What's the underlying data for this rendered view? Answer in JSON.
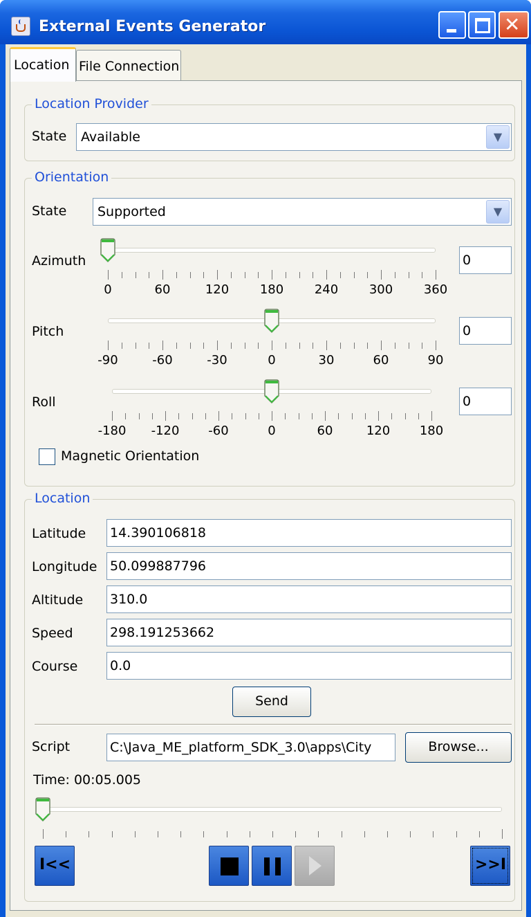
{
  "window": {
    "title": "External Events Generator",
    "title_icon": "java-cup-icon",
    "controls": [
      "minimize-icon",
      "maximize-icon",
      "close-icon"
    ],
    "close_glyph": "✕"
  },
  "tabs": [
    {
      "label": "Location",
      "active": true
    },
    {
      "label": "File Connection",
      "active": false
    }
  ],
  "location_provider": {
    "group_title": "Location Provider",
    "state_label": "State",
    "state_value": "Available"
  },
  "orientation": {
    "group_title": "Orientation",
    "state_label": "State",
    "state_value": "Supported",
    "azimuth": {
      "label": "Azimuth",
      "value": "0",
      "min": 0,
      "max": 360,
      "current": 0,
      "tick_labels": [
        "0",
        "60",
        "120",
        "180",
        "240",
        "300",
        "360"
      ]
    },
    "pitch": {
      "label": "Pitch",
      "value": "0",
      "min": -90,
      "max": 90,
      "current": 0,
      "tick_labels": [
        "-90",
        "-60",
        "-30",
        "0",
        "30",
        "60",
        "90"
      ]
    },
    "roll": {
      "label": "Roll",
      "value": "0",
      "min": -180,
      "max": 180,
      "current": 0,
      "tick_labels": [
        "-180",
        "-120",
        "-60",
        "0",
        "60",
        "120",
        "180"
      ]
    },
    "magnetic_label": "Magnetic Orientation",
    "magnetic_checked": false
  },
  "location": {
    "group_title": "Location",
    "fields": [
      {
        "label": "Latitude",
        "value": "14.390106818"
      },
      {
        "label": "Longitude",
        "value": "50.099887796"
      },
      {
        "label": "Altitude",
        "value": "310.0"
      },
      {
        "label": "Speed",
        "value": "298.191253662"
      },
      {
        "label": "Course",
        "value": "0.0"
      }
    ],
    "send_label": "Send",
    "script_label": "Script",
    "script_value": "C:\\Java_ME_platform_SDK_3.0\\apps\\City",
    "browse_label": "Browse...",
    "time_label": "Time: 00:05.005",
    "time_position": 0.0
  },
  "player": {
    "rewind_label": "I<<",
    "stop_icon": "stop-icon",
    "pause_icon": "pause-icon",
    "play_icon": "play-icon",
    "play_enabled": false,
    "forward_label": ">>I"
  }
}
